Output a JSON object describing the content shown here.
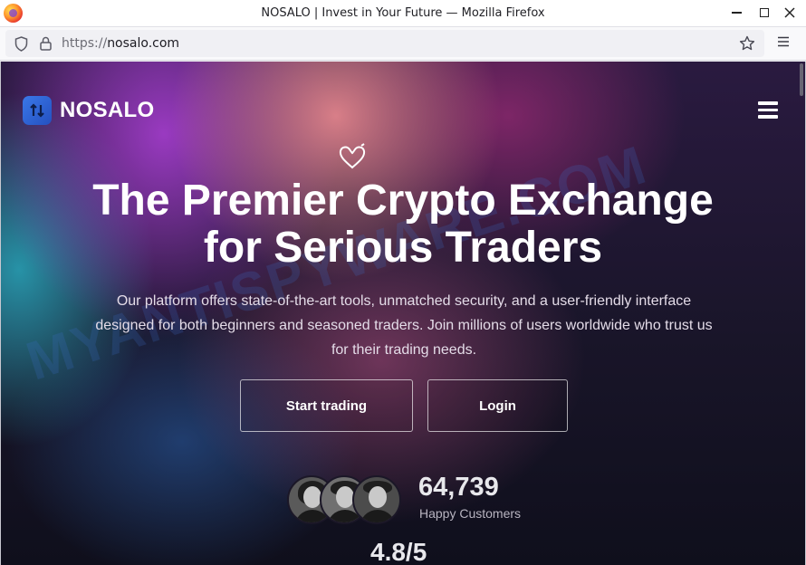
{
  "window": {
    "title": "NOSALO | Invest in Your Future — Mozilla Firefox"
  },
  "urlbar": {
    "protocol": "https://",
    "domain": "nosalo.com"
  },
  "site": {
    "brand_name": "NOSALO",
    "hero_title_line1": "The Premier Crypto Exchange",
    "hero_title_line2": "for Serious Traders",
    "hero_description": "Our platform offers state-of-the-art tools, unmatched security, and a user-friendly interface designed for both beginners and seasoned traders. Join millions of users worldwide who trust us for their trading needs.",
    "buttons": {
      "start_trading": "Start trading",
      "login": "Login"
    },
    "stats": {
      "customers_count": "64,739",
      "customers_label": "Happy Customers",
      "rating": "4.8/5"
    }
  },
  "watermark": "MYANTISPYWARE.COM",
  "colors": {
    "brand_logo": "#2f63d6",
    "text_primary": "#ffffff",
    "background_dark": "#191529"
  },
  "icons": [
    "firefox-logo",
    "shield-icon",
    "lock-icon",
    "star-icon",
    "menu-icon",
    "hamburger-icon",
    "heart-icon"
  ]
}
